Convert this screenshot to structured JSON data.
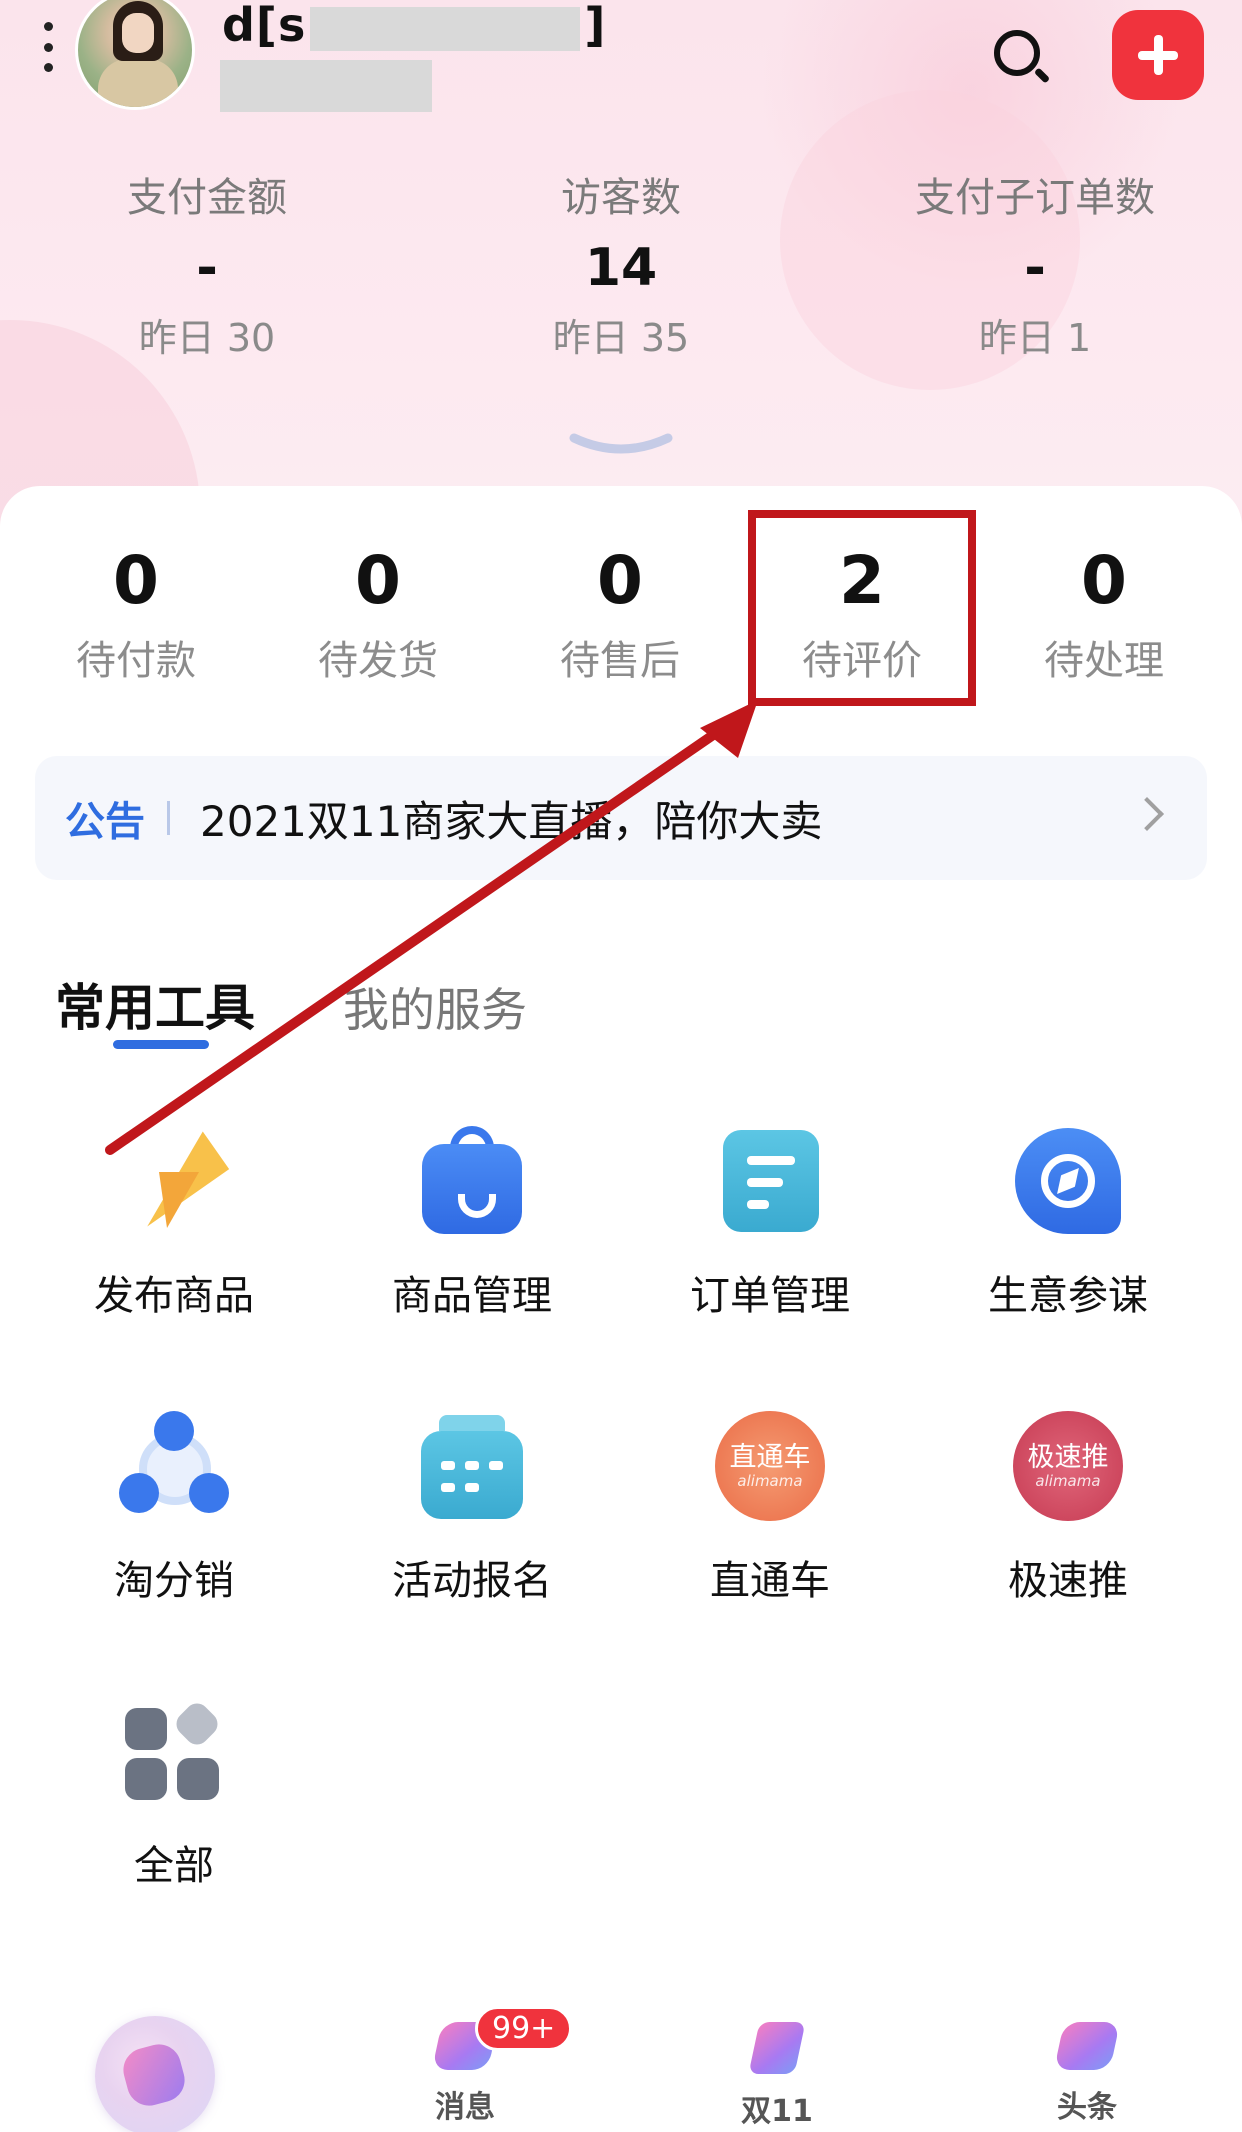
{
  "header": {
    "username_prefix": "d[s",
    "username_suffix": "]",
    "stats": [
      {
        "label": "支付金额",
        "value": "-",
        "yesterday": "昨日 30"
      },
      {
        "label": "访客数",
        "value": "14",
        "yesterday": "昨日 35"
      },
      {
        "label": "支付子订单数",
        "value": "-",
        "yesterday": "昨日 1"
      }
    ]
  },
  "orders": [
    {
      "count": "0",
      "label": "待付款"
    },
    {
      "count": "0",
      "label": "待发货"
    },
    {
      "count": "0",
      "label": "待售后"
    },
    {
      "count": "2",
      "label": "待评价"
    },
    {
      "count": "0",
      "label": "待处理"
    }
  ],
  "notice": {
    "tag": "公告",
    "text": "2021双11商家大直播，陪你大卖"
  },
  "tabs": {
    "active": "常用工具",
    "inactive": "我的服务"
  },
  "tools": [
    {
      "label": "发布商品",
      "icon": "paper-plane-icon"
    },
    {
      "label": "商品管理",
      "icon": "shopping-bag-icon"
    },
    {
      "label": "订单管理",
      "icon": "document-list-icon"
    },
    {
      "label": "生意参谋",
      "icon": "compass-icon"
    },
    {
      "label": "淘分销",
      "icon": "share-network-icon"
    },
    {
      "label": "活动报名",
      "icon": "calendar-icon"
    },
    {
      "label": "直通车",
      "icon": "ztc-alimama-icon",
      "icon_text": "直通车",
      "icon_sub": "alimama"
    },
    {
      "label": "极速推",
      "icon": "jst-alimama-icon",
      "icon_text": "极速推",
      "icon_sub": "alimama"
    },
    {
      "label": "全部",
      "icon": "all-grid-icon"
    }
  ],
  "bottom_nav": {
    "items": [
      {
        "label": "",
        "icon": "home-logo-icon"
      },
      {
        "label": "消息",
        "icon": "message-icon",
        "badge": "99+"
      },
      {
        "label": "双11",
        "icon": "double11-icon"
      },
      {
        "label": "头条",
        "icon": "headline-icon"
      }
    ]
  },
  "colors": {
    "accent_blue": "#2f6de0",
    "highlight_red": "#c0171b",
    "add_button_red": "#f0333d",
    "ztc_orange": "#ee7a55",
    "jst_red": "#cf4a5e"
  }
}
